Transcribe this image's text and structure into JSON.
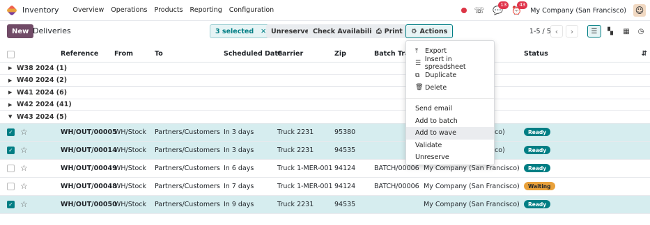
{
  "navbar": {
    "app_name": "Inventory",
    "menu": [
      "Overview",
      "Operations",
      "Products",
      "Reporting",
      "Configuration"
    ],
    "chat_count": "13",
    "activity_count": "43",
    "company": "My Company (San Francisco)"
  },
  "control": {
    "new_label": "New",
    "title": "Deliveries",
    "selected_label": "3 selected",
    "unreserve_label": "Unreserve",
    "check_availability_label": "Check Availability",
    "print_label": "Print",
    "actions_label": "Actions",
    "pager": "1-5 / 5"
  },
  "columns": [
    "Reference",
    "From",
    "To",
    "Scheduled Date",
    "Carrier",
    "Zip",
    "Batch Tran",
    "Status"
  ],
  "groups": [
    {
      "label": "W38 2024 (1)",
      "expanded": false
    },
    {
      "label": "W40 2024 (2)",
      "expanded": false
    },
    {
      "label": "W41 2024 (6)",
      "expanded": false
    },
    {
      "label": "W42 2024 (41)",
      "expanded": false
    },
    {
      "label": "W43 2024 (5)",
      "expanded": true
    }
  ],
  "rows": [
    {
      "selected": true,
      "reference": "WH/OUT/00005",
      "from": "WH/Stock",
      "to": "Partners/Customers",
      "scheduled": "In 3 days",
      "carrier": "Truck 2231",
      "zip": "95380",
      "batch": "",
      "company": "co)",
      "status": "Ready"
    },
    {
      "selected": true,
      "reference": "WH/OUT/00014",
      "from": "WH/Stock",
      "to": "Partners/Customers",
      "scheduled": "In 3 days",
      "carrier": "Truck 2231",
      "zip": "94535",
      "batch": "",
      "company": "co)",
      "status": "Ready"
    },
    {
      "selected": false,
      "reference": "WH/OUT/00049",
      "from": "WH/Stock",
      "to": "Partners/Customers",
      "scheduled": "In 6 days",
      "carrier": "Truck 1-MER-001",
      "zip": "94124",
      "batch": "BATCH/00006",
      "company": "My Company (San Francisco)",
      "status": "Ready"
    },
    {
      "selected": false,
      "reference": "WH/OUT/00048",
      "from": "WH/Stock",
      "to": "Partners/Customers",
      "scheduled": "In 7 days",
      "carrier": "Truck 1-MER-001",
      "zip": "94124",
      "batch": "BATCH/00006",
      "company": "My Company (San Francisco)",
      "status": "Waiting"
    },
    {
      "selected": true,
      "reference": "WH/OUT/00050",
      "from": "WH/Stock",
      "to": "Partners/Customers",
      "scheduled": "In 9 days",
      "carrier": "Truck 2231",
      "zip": "94535",
      "batch": "",
      "company": "My Company (San Francisco)",
      "status": "Ready"
    }
  ],
  "actions_menu": {
    "group1": [
      "Export",
      "Insert in spreadsheet",
      "Duplicate",
      "Delete"
    ],
    "group2": [
      "Send email",
      "Add to batch",
      "Add to wave",
      "Validate",
      "Unreserve"
    ],
    "hovered": "Add to wave"
  }
}
